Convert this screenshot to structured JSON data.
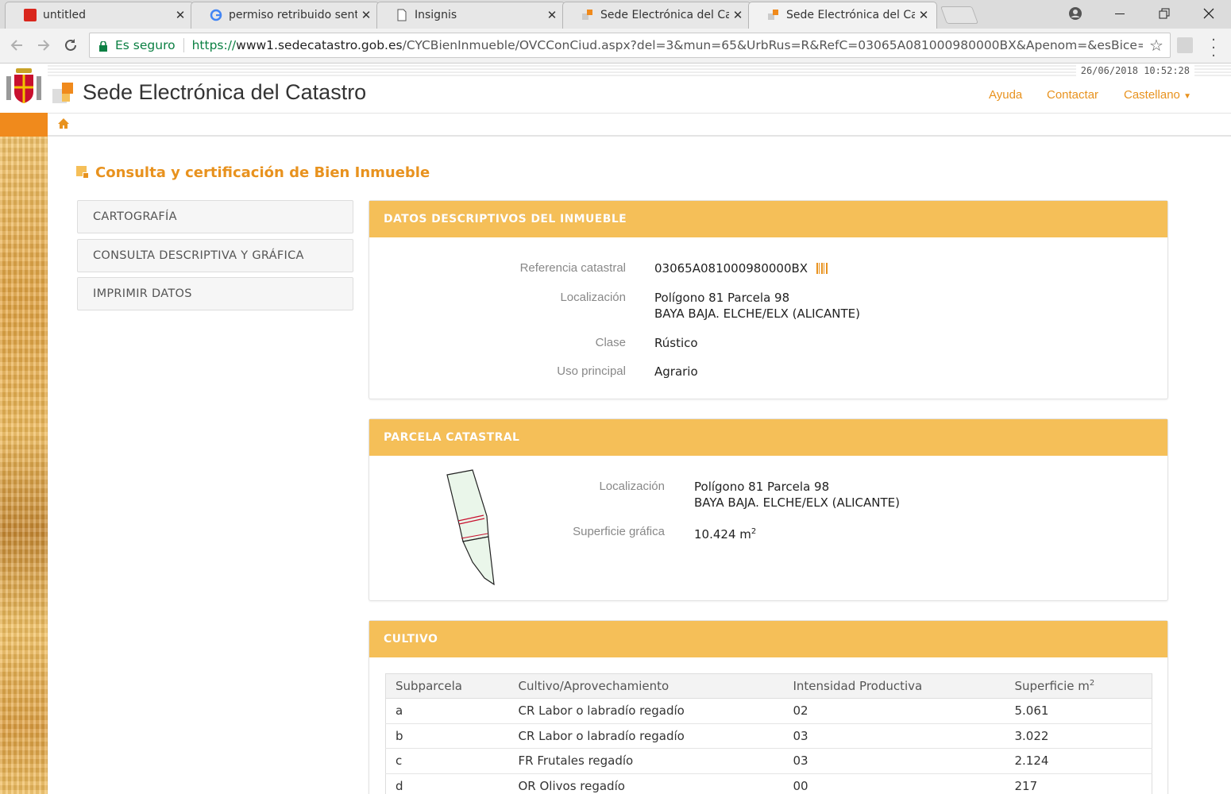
{
  "browser": {
    "tabs": [
      {
        "title": "untitled",
        "icon": "red-app-icon"
      },
      {
        "title": "permiso retribuido sente",
        "icon": "google-icon"
      },
      {
        "title": "Insignis",
        "icon": "document-icon"
      },
      {
        "title": "Sede Electrónica del Cata",
        "icon": "catastro-icon"
      },
      {
        "title": "Sede Electrónica del Cata",
        "icon": "catastro-icon"
      }
    ],
    "close_glyph": "✕",
    "secure_label": "Es seguro",
    "url_prefix": "https://",
    "url_domain": "www1.sedecatastro.gob.es",
    "url_rest": "/CYCBienInmueble/OVCConCiud.aspx?del=3&mun=65&UrbRus=R&RefC=03065A081000980000BX&Apenom=&esBice=&R..."
  },
  "header": {
    "datetime": "26/06/2018  10:52:28",
    "site_title": "Sede Electrónica del Catastro",
    "links": [
      "Ayuda",
      "Contactar",
      "Castellano"
    ]
  },
  "page_title": "Consulta y certificación de Bien Inmueble",
  "menu": [
    "CARTOGRAFÍA",
    "CONSULTA DESCRIPTIVA Y GRÁFICA",
    "IMPRIMIR DATOS"
  ],
  "descriptivos": {
    "heading": "DATOS DESCRIPTIVOS DEL INMUEBLE",
    "ref_label": "Referencia catastral",
    "ref_value": "03065A081000980000BX",
    "loc_label": "Localización",
    "loc_line1": "Polígono 81 Parcela 98",
    "loc_line2": "BAYA BAJA. ELCHE/ELX (ALICANTE)",
    "clase_label": "Clase",
    "clase_value": "Rústico",
    "uso_label": "Uso principal",
    "uso_value": "Agrario"
  },
  "parcela": {
    "heading": "PARCELA CATASTRAL",
    "loc_label": "Localización",
    "loc_line1": "Polígono 81 Parcela 98",
    "loc_line2": "BAYA BAJA. ELCHE/ELX (ALICANTE)",
    "sup_label": "Superficie gráfica",
    "sup_value": "10.424 m",
    "sup_exp": "2"
  },
  "cultivo": {
    "heading": "CULTIVO",
    "columns": [
      "Subparcela",
      "Cultivo/Aprovechamiento",
      "Intensidad Productiva",
      "Superficie m"
    ],
    "col_exp": "2",
    "rows": [
      [
        "a",
        "CR Labor o labradío regadío",
        "02",
        "5.061"
      ],
      [
        "b",
        "CR Labor o labradío regadío",
        "03",
        "3.022"
      ],
      [
        "c",
        "FR Frutales regadío",
        "03",
        "2.124"
      ],
      [
        "d",
        "OR Olivos regadío",
        "00",
        "217"
      ]
    ]
  },
  "colors": {
    "accent": "#e8921e",
    "panel_head": "#f5bf58"
  }
}
